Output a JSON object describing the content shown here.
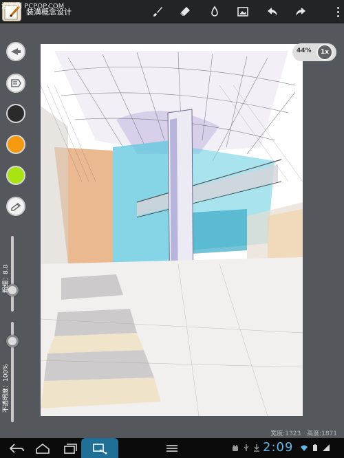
{
  "watermark": "泡泡网 PCPOP.COM",
  "app": {
    "title": "装潢概念设计"
  },
  "toolbar": {
    "icons": [
      "brush-icon",
      "eraser-icon",
      "dropper-icon",
      "image-icon",
      "undo-icon",
      "redo-icon",
      "overflow-menu-icon"
    ]
  },
  "tools": {
    "colors": [
      "#2a2a2a",
      "#f59a0e",
      "#a9e312"
    ],
    "size_label": "粗细：8.0",
    "opacity_label": "不透明度：100%"
  },
  "canvas": {
    "zoom_percent": "44%",
    "zoom_button": "1x"
  },
  "dimensions": {
    "width_label": "宽度:1323",
    "height_label": "高度:1871"
  },
  "system": {
    "time": "2:09"
  }
}
